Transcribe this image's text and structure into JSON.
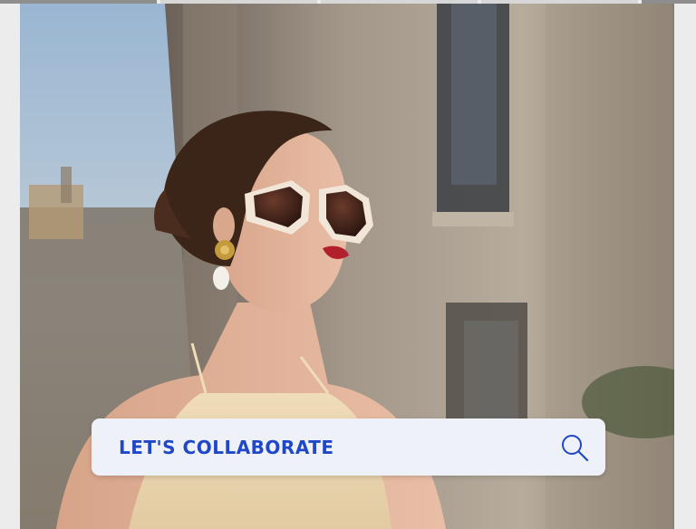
{
  "story": {
    "segments": [
      "done",
      "pending",
      "pending",
      "pending",
      "pending"
    ]
  },
  "photo": {
    "alt_semantic": "fashion-portrait-photo"
  },
  "search": {
    "label": "LET'S COLLABORATE",
    "icon": "search-icon",
    "accent_color": "#2047c8",
    "background_color": "#eef2f8"
  }
}
